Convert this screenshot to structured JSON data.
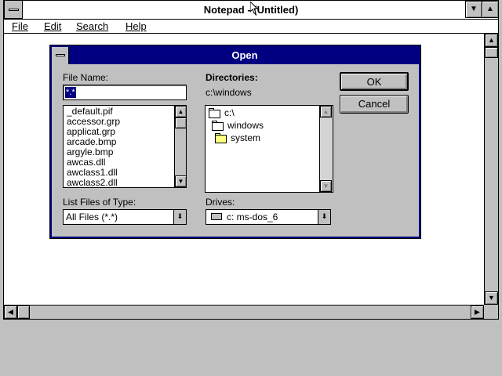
{
  "window": {
    "title": "Notepad - (Untitled)",
    "menu": [
      {
        "label": "File"
      },
      {
        "label": "Edit"
      },
      {
        "label": "Search"
      },
      {
        "label": "Help"
      }
    ]
  },
  "dialog": {
    "title": "Open",
    "file_name_label": "File Name:",
    "file_name_value": "*.*",
    "files": [
      "_default.pif",
      "accessor.grp",
      "applicat.grp",
      "arcade.bmp",
      "argyle.bmp",
      "awcas.dll",
      "awclass1.dll",
      "awclass2.dll"
    ],
    "directories_label": "Directories:",
    "current_path": "c:\\windows",
    "dirs": [
      {
        "name": "c:\\"
      },
      {
        "name": "windows"
      },
      {
        "name": "system"
      }
    ],
    "list_type_label": "List Files of Type:",
    "list_type_value": "All Files (*.*)",
    "drives_label": "Drives:",
    "drive_value": "c: ms-dos_6",
    "ok_label": "OK",
    "cancel_label": "Cancel"
  },
  "icons": {
    "arrow_up": "▲",
    "arrow_down": "▼",
    "arrow_left": "◀",
    "arrow_right": "▶",
    "combo_arrow": "⬇"
  }
}
